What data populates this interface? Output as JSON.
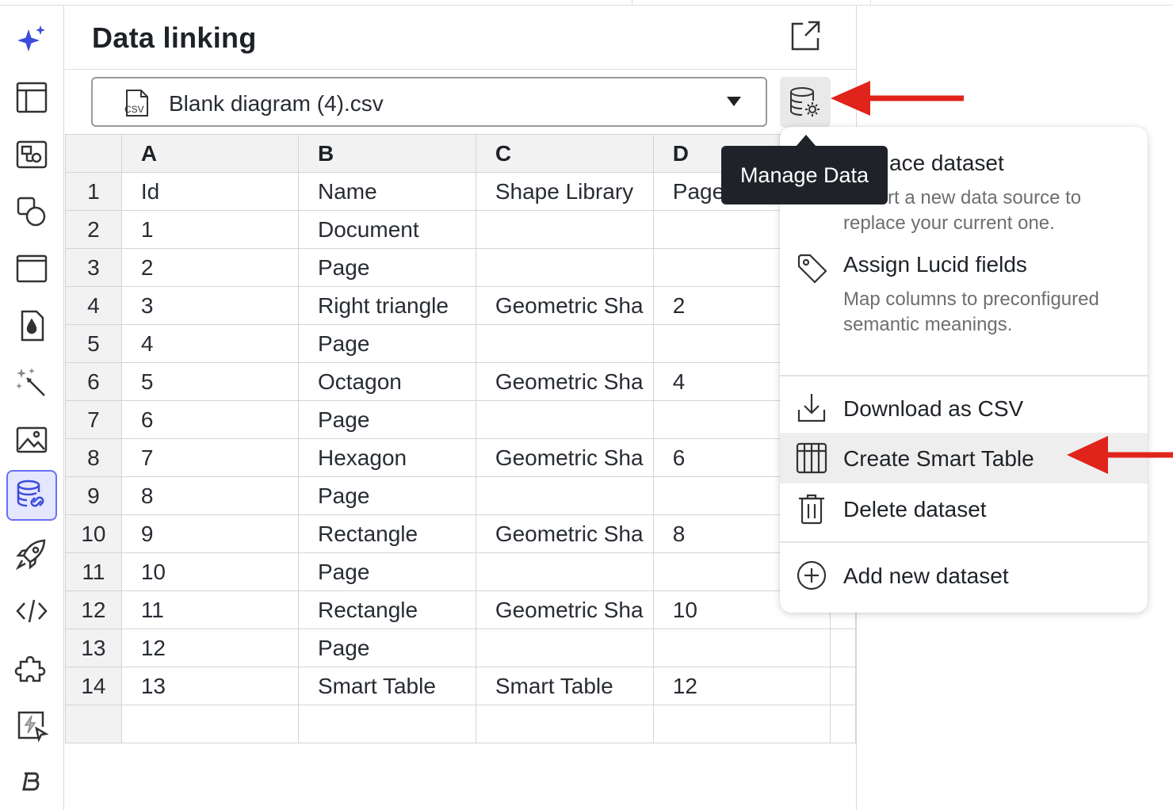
{
  "panel": {
    "title": "Data linking",
    "dataset_name": "Blank diagram (4).csv",
    "csv_icon_text": "CSV"
  },
  "sidebar": {
    "items": [
      {
        "name": "ai-sparkle-icon",
        "active": false
      },
      {
        "name": "layout-icon",
        "active": false
      },
      {
        "name": "shapes-library-icon",
        "active": false
      },
      {
        "name": "shapes-icon",
        "active": false
      },
      {
        "name": "frame-icon",
        "active": false
      },
      {
        "name": "fill-drop-icon",
        "active": false
      },
      {
        "name": "magic-wand-icon",
        "active": false
      },
      {
        "name": "image-icon",
        "active": false
      },
      {
        "name": "data-linking-icon",
        "active": true
      },
      {
        "name": "rocket-icon",
        "active": false
      },
      {
        "name": "code-icon",
        "active": false
      },
      {
        "name": "puzzle-icon",
        "active": false
      },
      {
        "name": "lightning-cursor-icon",
        "active": false
      },
      {
        "name": "brand-b-icon",
        "active": false
      }
    ]
  },
  "grid": {
    "columns": [
      "A",
      "B",
      "C",
      "D"
    ],
    "rows": [
      {
        "n": "1",
        "a": "Id",
        "b": "Name",
        "c": "Shape Library",
        "d": "Page"
      },
      {
        "n": "2",
        "a": "1",
        "b": "Document",
        "c": "",
        "d": ""
      },
      {
        "n": "3",
        "a": "2",
        "b": "Page",
        "c": "",
        "d": ""
      },
      {
        "n": "4",
        "a": "3",
        "b": "Right triangle",
        "c": "Geometric Sha",
        "d": "2"
      },
      {
        "n": "5",
        "a": "4",
        "b": "Page",
        "c": "",
        "d": ""
      },
      {
        "n": "6",
        "a": "5",
        "b": "Octagon",
        "c": "Geometric Sha",
        "d": "4"
      },
      {
        "n": "7",
        "a": "6",
        "b": "Page",
        "c": "",
        "d": ""
      },
      {
        "n": "8",
        "a": "7",
        "b": "Hexagon",
        "c": "Geometric Sha",
        "d": "6"
      },
      {
        "n": "9",
        "a": "8",
        "b": "Page",
        "c": "",
        "d": ""
      },
      {
        "n": "10",
        "a": "9",
        "b": "Rectangle",
        "c": "Geometric Sha",
        "d": "8"
      },
      {
        "n": "11",
        "a": "10",
        "b": "Page",
        "c": "",
        "d": ""
      },
      {
        "n": "12",
        "a": "11",
        "b": "Rectangle",
        "c": "Geometric Sha",
        "d": "10"
      },
      {
        "n": "13",
        "a": "12",
        "b": "Page",
        "c": "",
        "d": ""
      },
      {
        "n": "14",
        "a": "13",
        "b": "Smart Table",
        "c": "Smart Table",
        "d": "12"
      },
      {
        "n": "",
        "a": "",
        "b": "",
        "c": "",
        "d": ""
      }
    ]
  },
  "tooltip": {
    "text": "Manage Data"
  },
  "menu": {
    "replace": {
      "label": "ace dataset",
      "desc_line1": "rt a new data source to",
      "desc_line2": "replace your current one."
    },
    "assign": {
      "label": "Assign Lucid fields",
      "desc": "Map columns to preconfigured semantic meanings."
    },
    "download": {
      "label": "Download as CSV"
    },
    "smart_table": {
      "label": "Create Smart Table"
    },
    "delete": {
      "label": "Delete dataset"
    },
    "add": {
      "label": "Add new dataset"
    }
  },
  "colors": {
    "accent": "#6a6ff7",
    "annotation_arrow": "#e0241b",
    "tooltip_bg": "#1f2329"
  }
}
